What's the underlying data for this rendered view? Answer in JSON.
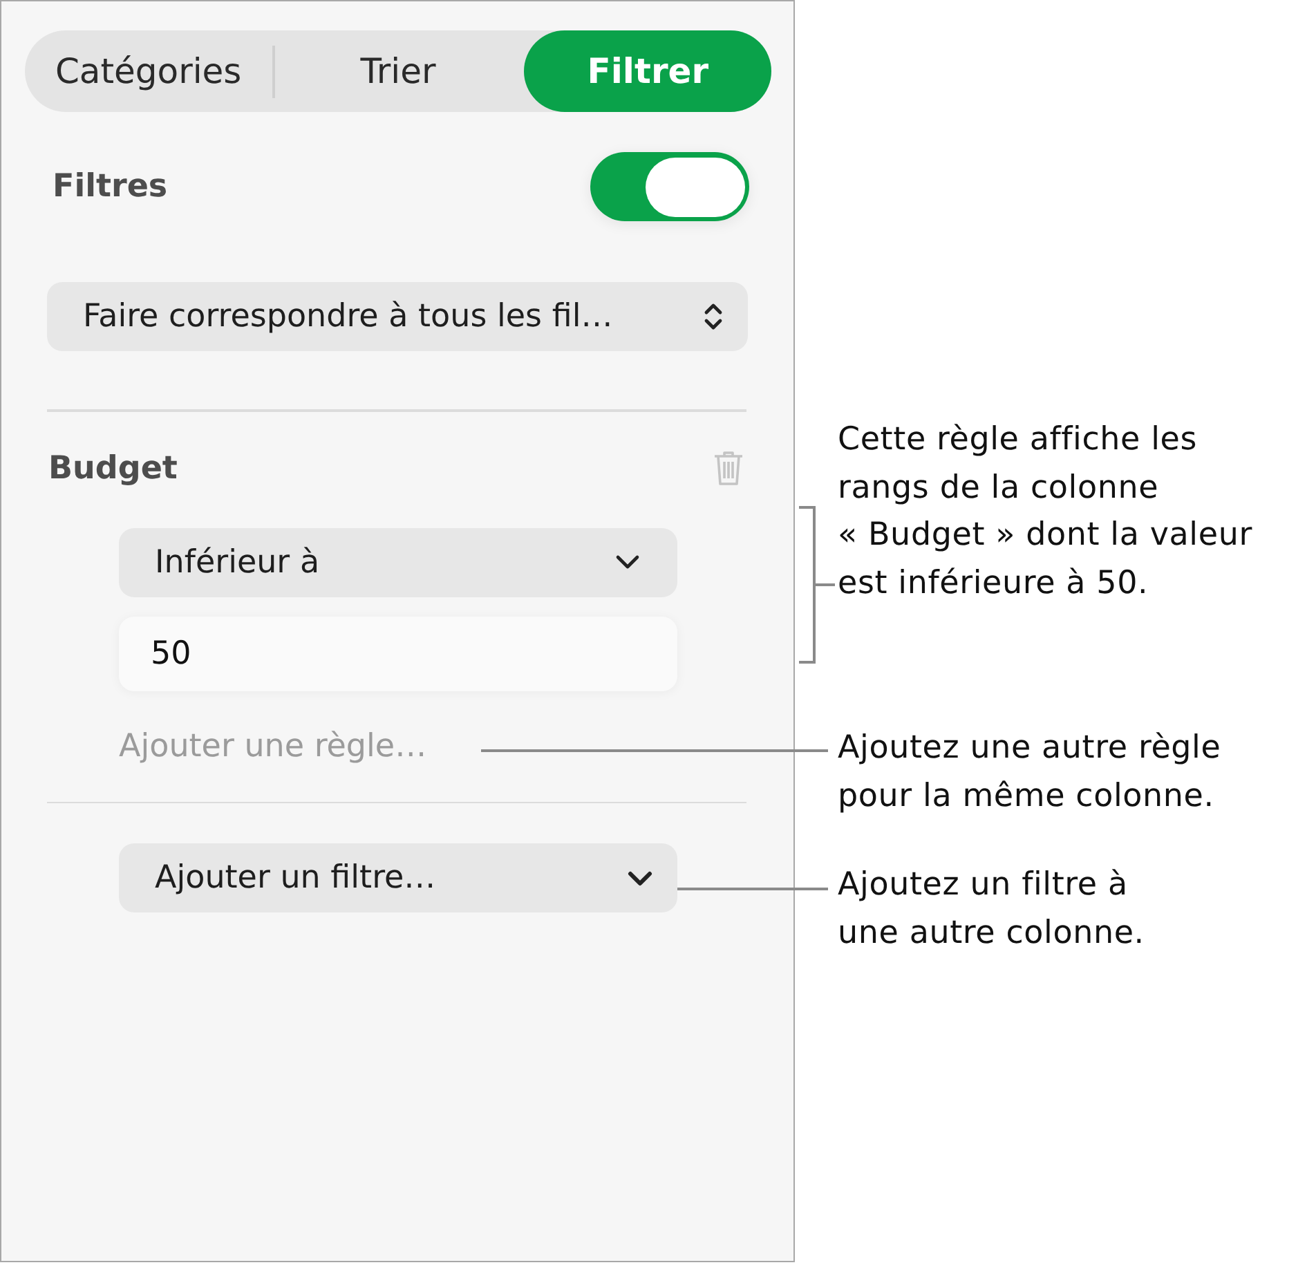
{
  "tabs": [
    {
      "label": "Catégories",
      "selected": false
    },
    {
      "label": "Trier",
      "selected": false
    },
    {
      "label": "Filtrer",
      "selected": true
    }
  ],
  "filters_toggle": {
    "label": "Filtres",
    "on": true
  },
  "match_popup": {
    "value": "Faire correspondre à tous les fil…"
  },
  "rules": [
    {
      "column": "Budget",
      "condition": "Inférieur à",
      "value": "50",
      "add_rule": "Ajouter une règle…"
    }
  ],
  "add_filter": {
    "label": "Ajouter un filtre…"
  },
  "callouts": [
    {
      "kind": "bracket",
      "lines": [
        "Cette règle affiche les",
        "rangs de la colonne",
        "« Budget » dont la valeur",
        "est inférieure à 50."
      ]
    },
    {
      "kind": "line",
      "lines": [
        "Ajoutez une autre règle",
        "pour la même colonne."
      ]
    },
    {
      "kind": "line",
      "lines": [
        "Ajoutez un filtre à",
        "une autre colonne."
      ]
    }
  ]
}
